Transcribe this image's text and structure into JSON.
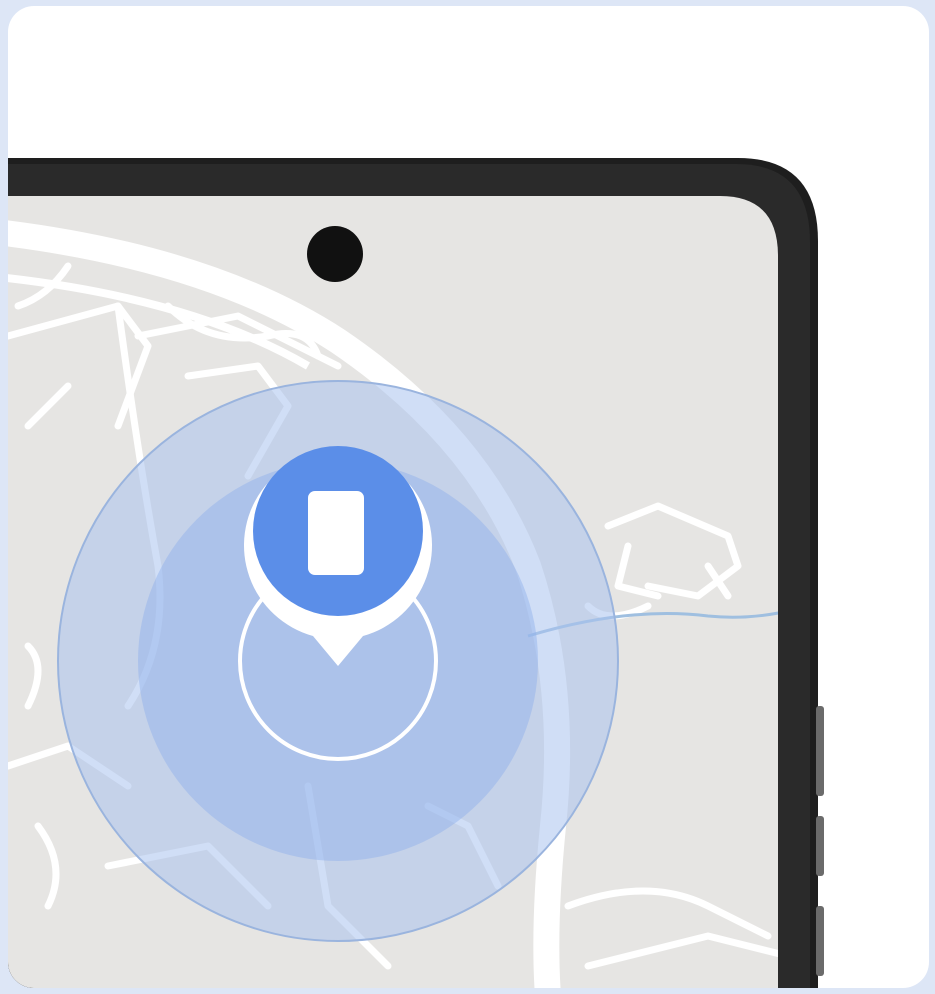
{
  "illustration": {
    "subject": "phone-on-map-with-location-pin",
    "icons": {
      "device": "phone-icon",
      "pin": "location-pin-icon",
      "camera": "front-camera-icon"
    },
    "colors": {
      "background": "#dde6f6",
      "card": "#ffffff",
      "map_land": "#e6e5e3",
      "map_roads": "#ffffff",
      "accuracy_outer": "#a9c3ee",
      "accuracy_inner": "#8fb0ea",
      "pin_fill": "#5b8ee8",
      "phone_frame": "#1e1e1e"
    }
  }
}
